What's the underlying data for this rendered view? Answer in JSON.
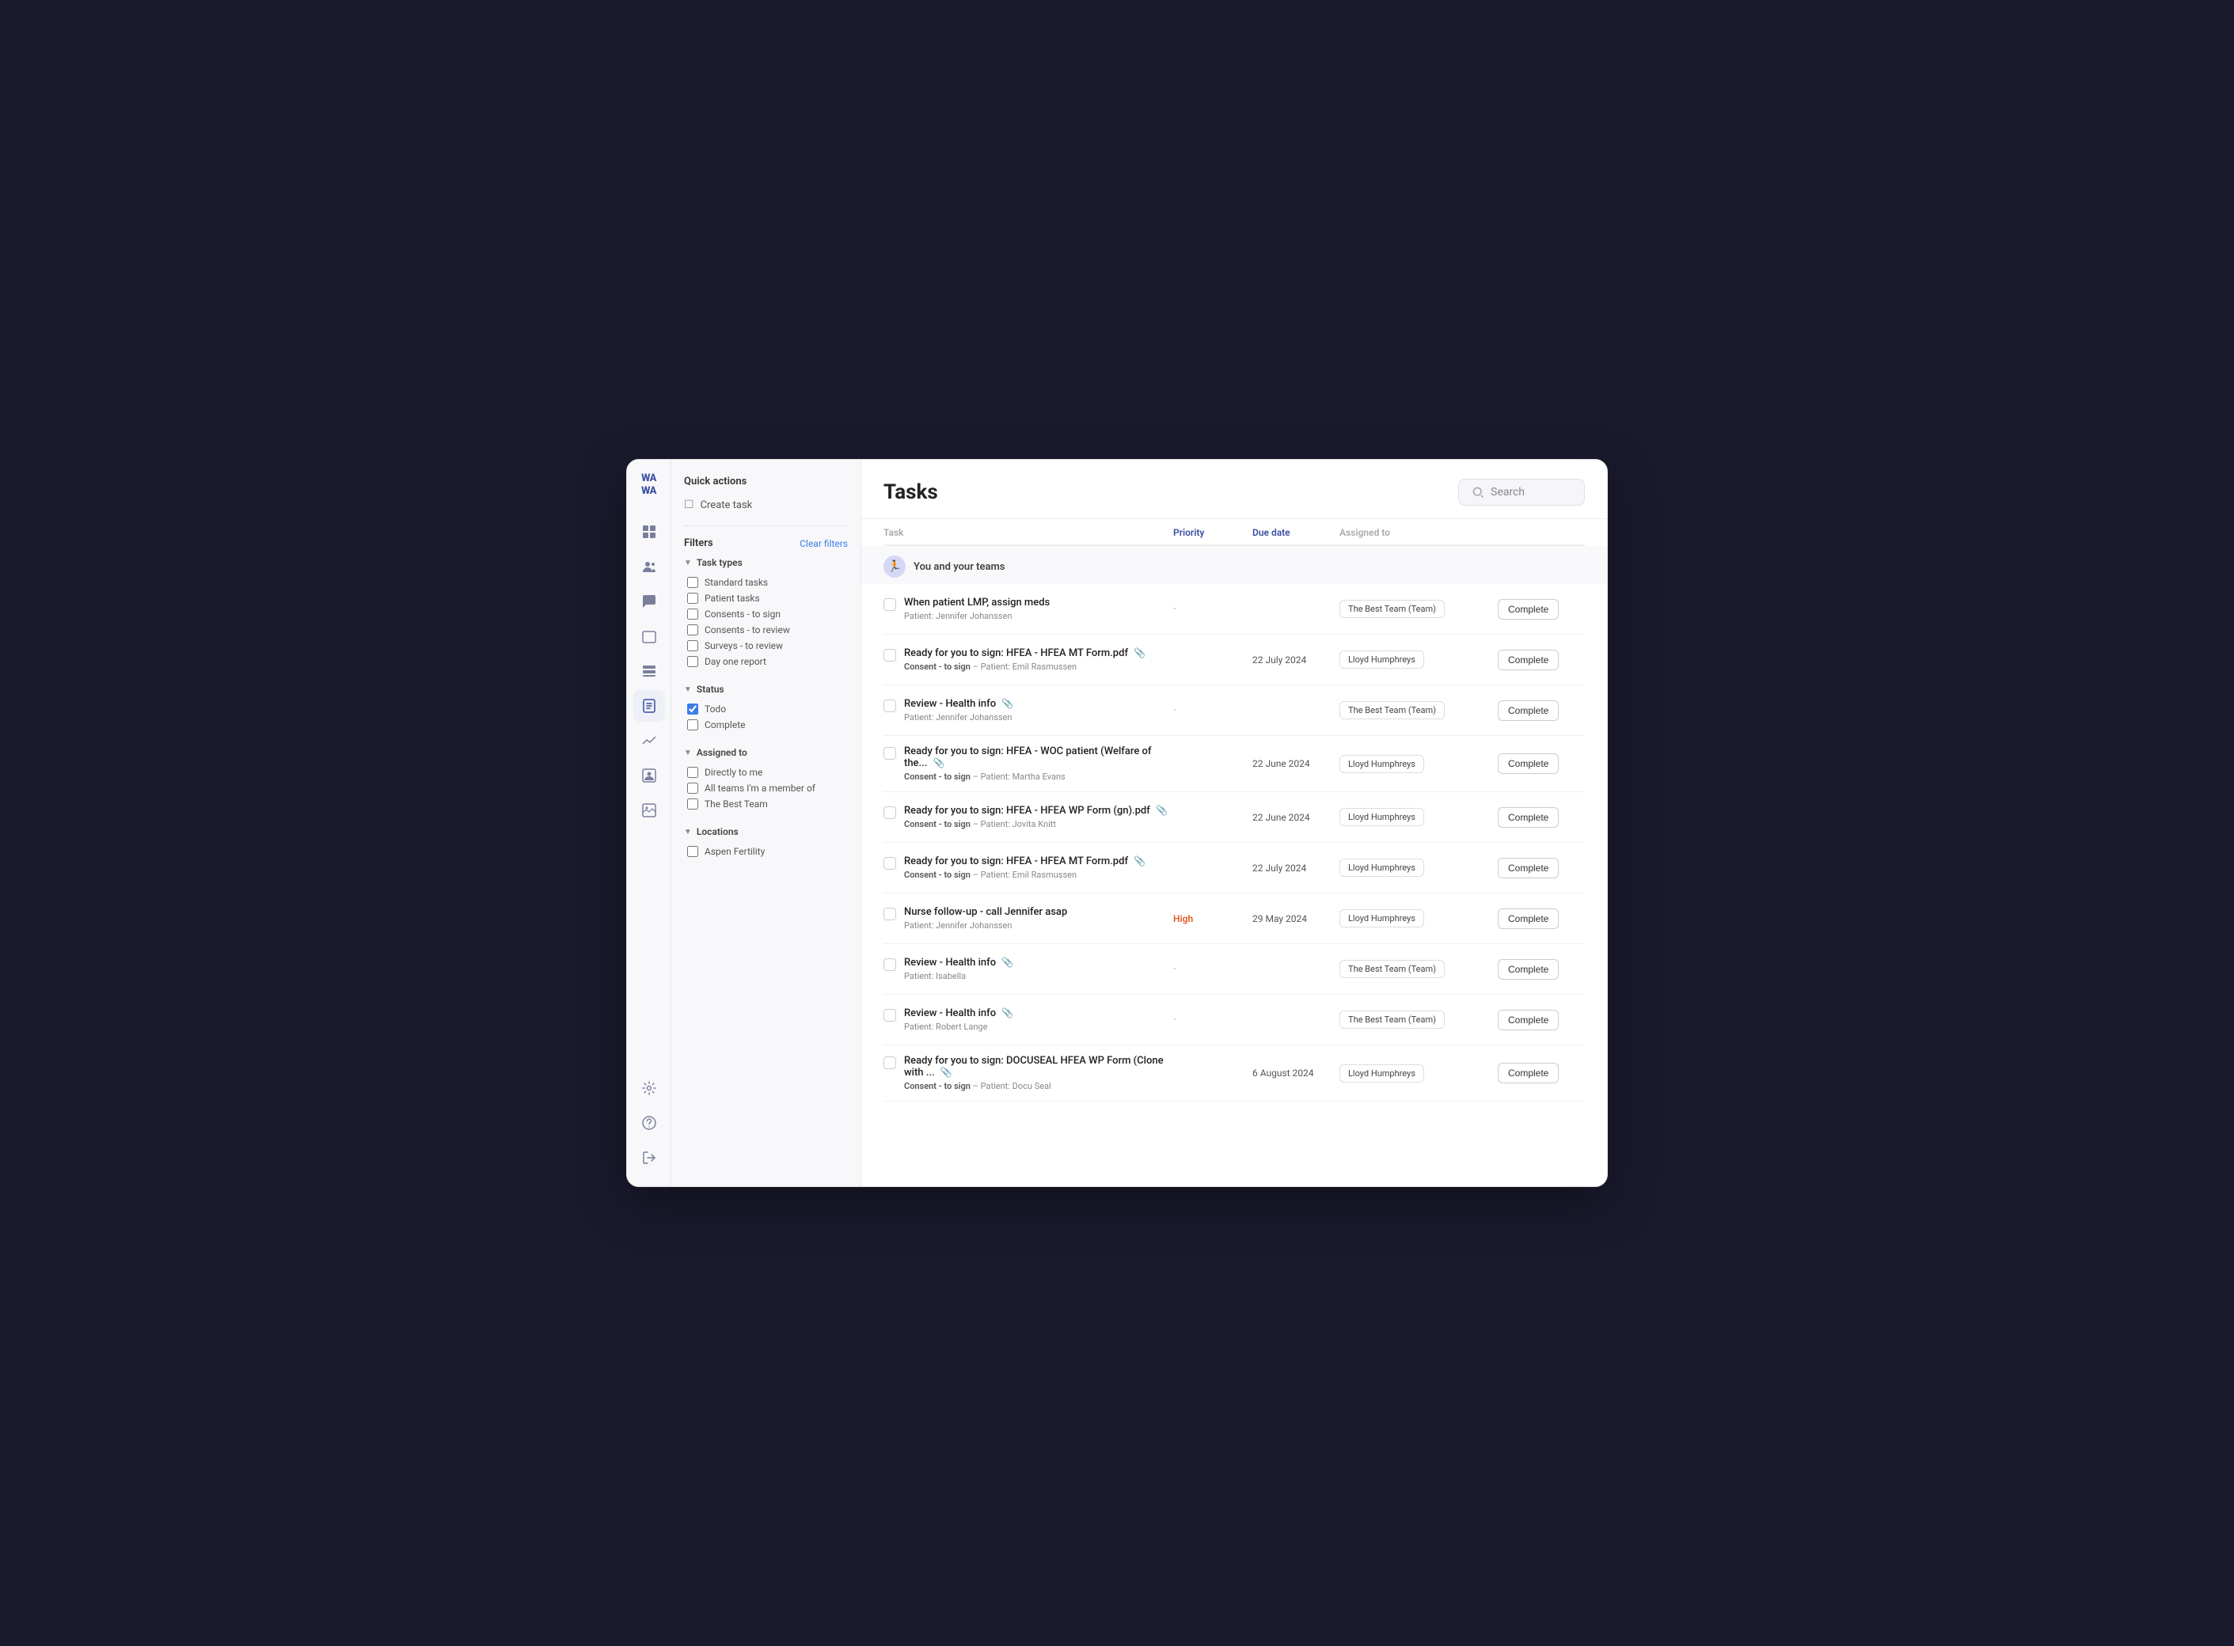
{
  "app": {
    "logo_line1": "WA",
    "logo_line2": "WA"
  },
  "header": {
    "title": "Tasks",
    "search_placeholder": "Search"
  },
  "quick_actions": {
    "title": "Quick actions",
    "items": [
      {
        "label": "Create task"
      }
    ]
  },
  "filters": {
    "title": "Filters",
    "clear_label": "Clear filters",
    "groups": [
      {
        "label": "Task types",
        "options": [
          {
            "label": "Standard tasks",
            "checked": false
          },
          {
            "label": "Patient tasks",
            "checked": false
          },
          {
            "label": "Consents - to sign",
            "checked": false
          },
          {
            "label": "Consents - to review",
            "checked": false
          },
          {
            "label": "Surveys - to review",
            "checked": false
          },
          {
            "label": "Day one report",
            "checked": false
          }
        ]
      },
      {
        "label": "Status",
        "options": [
          {
            "label": "Todo",
            "checked": true
          },
          {
            "label": "Complete",
            "checked": false
          }
        ]
      },
      {
        "label": "Assigned to",
        "options": [
          {
            "label": "Directly to me",
            "checked": false
          },
          {
            "label": "All teams I'm a member of",
            "checked": false
          },
          {
            "label": "The Best Team",
            "checked": false
          }
        ]
      },
      {
        "label": "Locations",
        "options": [
          {
            "label": "Aspen Fertility",
            "checked": false
          }
        ]
      }
    ]
  },
  "table": {
    "columns": [
      {
        "label": "Task",
        "key": "task"
      },
      {
        "label": "Priority",
        "key": "priority"
      },
      {
        "label": "Due date",
        "key": "due_date"
      },
      {
        "label": "Assigned to",
        "key": "assigned_to"
      },
      {
        "label": "",
        "key": "action"
      }
    ],
    "group_label": "You and your teams",
    "rows": [
      {
        "name": "When patient LMP, assign meds",
        "sub_tag": "",
        "sub_patient": "Patient: Jennifer Johanssen",
        "has_attachment": false,
        "priority": "-",
        "due_date": "",
        "assignee": "The Best Team (Team)",
        "action": "Complete"
      },
      {
        "name": "Ready for you to sign: HFEA - HFEA MT Form.pdf",
        "sub_tag": "Consent - to sign",
        "sub_patient": "Patient: Emil Rasmussen",
        "has_attachment": true,
        "priority": "",
        "due_date": "22 July 2024",
        "assignee": "Lloyd Humphreys",
        "action": "Complete"
      },
      {
        "name": "Review - Health info",
        "sub_tag": "",
        "sub_patient": "Patient: Jennifer Johanssen",
        "has_attachment": true,
        "priority": "-",
        "due_date": "",
        "assignee": "The Best Team (Team)",
        "action": "Complete"
      },
      {
        "name": "Ready for you to sign: HFEA - WOC patient (Welfare of the...",
        "sub_tag": "Consent - to sign",
        "sub_patient": "Patient: Martha Evans",
        "has_attachment": true,
        "priority": "",
        "due_date": "22 June 2024",
        "assignee": "Lloyd Humphreys",
        "action": "Complete"
      },
      {
        "name": "Ready for you to sign: HFEA - HFEA WP Form (gn).pdf",
        "sub_tag": "Consent - to sign",
        "sub_patient": "Patient: Jovita Knitt",
        "has_attachment": true,
        "priority": "",
        "due_date": "22 June 2024",
        "assignee": "Lloyd Humphreys",
        "action": "Complete"
      },
      {
        "name": "Ready for you to sign: HFEA - HFEA MT Form.pdf",
        "sub_tag": "Consent - to sign",
        "sub_patient": "Patient: Emil Rasmussen",
        "has_attachment": true,
        "priority": "",
        "due_date": "22 July 2024",
        "assignee": "Lloyd Humphreys",
        "action": "Complete"
      },
      {
        "name": "Nurse follow-up - call Jennifer asap",
        "sub_tag": "",
        "sub_patient": "Patient: Jennifer Johanssen",
        "has_attachment": false,
        "priority": "High",
        "due_date": "29 May 2024",
        "assignee": "Lloyd Humphreys",
        "action": "Complete"
      },
      {
        "name": "Review - Health info",
        "sub_tag": "",
        "sub_patient": "Patient: Isabella",
        "has_attachment": true,
        "priority": "-",
        "due_date": "",
        "assignee": "The Best Team (Team)",
        "action": "Complete"
      },
      {
        "name": "Review - Health info",
        "sub_tag": "",
        "sub_patient": "Patient: Robert Lange",
        "has_attachment": true,
        "priority": "-",
        "due_date": "",
        "assignee": "The Best Team (Team)",
        "action": "Complete"
      },
      {
        "name": "Ready for you to sign: DOCUSEAL HFEA WP Form (Clone with ...",
        "sub_tag": "Consent - to sign",
        "sub_patient": "Patient: Docu Seal",
        "has_attachment": true,
        "priority": "",
        "due_date": "6 August 2024",
        "assignee": "Lloyd Humphreys",
        "action": "Complete"
      }
    ]
  },
  "nav_icons": [
    {
      "name": "dashboard-icon",
      "glyph": "⊞"
    },
    {
      "name": "users-icon",
      "glyph": "👥"
    },
    {
      "name": "chat-icon",
      "glyph": "💬"
    },
    {
      "name": "calendar-icon",
      "glyph": "📅"
    },
    {
      "name": "card-icon",
      "glyph": "🗂"
    },
    {
      "name": "tasks-icon",
      "glyph": "📋"
    },
    {
      "name": "chart-icon",
      "glyph": "📈"
    },
    {
      "name": "profile-icon",
      "glyph": "👤"
    },
    {
      "name": "gallery-icon",
      "glyph": "🖼"
    }
  ],
  "bottom_icons": [
    {
      "name": "settings-icon",
      "glyph": "⚙"
    },
    {
      "name": "help-icon",
      "glyph": "❓"
    },
    {
      "name": "logout-icon",
      "glyph": "↪"
    }
  ]
}
